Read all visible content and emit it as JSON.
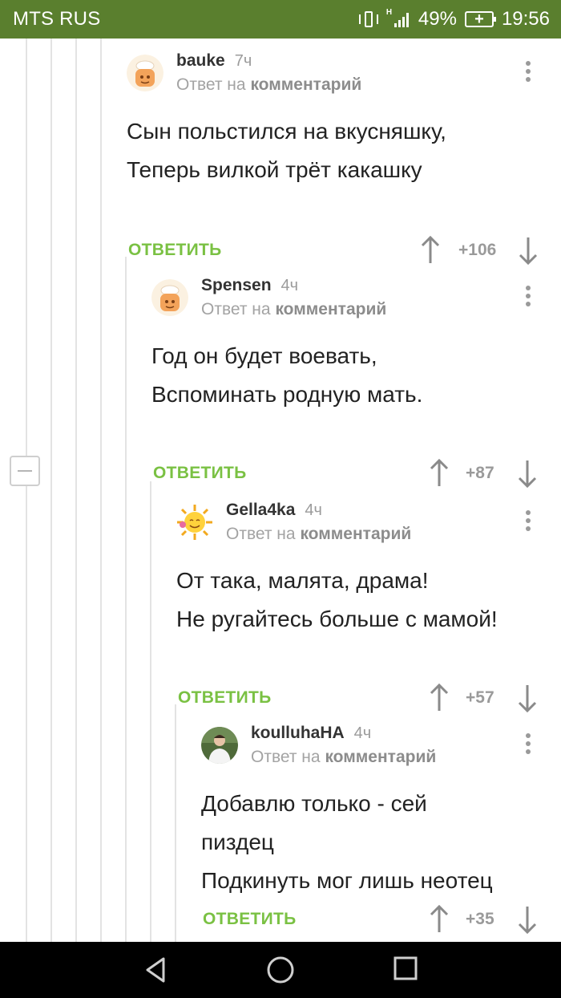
{
  "status_bar": {
    "carrier": "MTS RUS",
    "battery": "49%",
    "time": "19:56",
    "network": "H",
    "colors": {
      "bar": "#5a7f2e",
      "text": "#ffffff"
    }
  },
  "accent_color": "#7ac143",
  "comments": [
    {
      "author": "bauke",
      "time": "7ч",
      "reply_prefix": "Ответ на",
      "reply_target": "комментарий",
      "lines": [
        "Сын польстился на вкусняшку,",
        "Теперь вилкой трёт какашку"
      ],
      "reply_label": "ОТВЕТИТЬ",
      "score": "+106",
      "avatar_icon": "chef-avatar-icon"
    },
    {
      "author": "Spensen",
      "time": "4ч",
      "reply_prefix": "Ответ на",
      "reply_target": "комментарий",
      "lines": [
        "Год он будет воевать,",
        "Вспоминать родную мать."
      ],
      "reply_label": "ОТВЕТИТЬ",
      "score": "+87",
      "avatar_icon": "chef-avatar-icon"
    },
    {
      "author": "Gella4ka",
      "time": "4ч",
      "reply_prefix": "Ответ на",
      "reply_target": "комментарий",
      "lines": [
        "От така, малята, драма!",
        "Не ругайтесь больше с мамой!"
      ],
      "reply_label": "ОТВЕТИТЬ",
      "score": "+57",
      "avatar_icon": "sun-avatar-icon"
    },
    {
      "author": "koulluhaHA",
      "time": "4ч",
      "reply_prefix": "Ответ на",
      "reply_target": "комментарий",
      "lines": [
        "Добавлю только - сей",
        "пиздец",
        "Подкинуть мог лишь неотец"
      ],
      "reply_label": "ОТВЕТИТЬ",
      "score": "+35",
      "avatar_icon": "photo-avatar-icon"
    }
  ],
  "nav_bar": {
    "back": "back-icon",
    "home": "home-icon",
    "recents": "recents-icon"
  }
}
